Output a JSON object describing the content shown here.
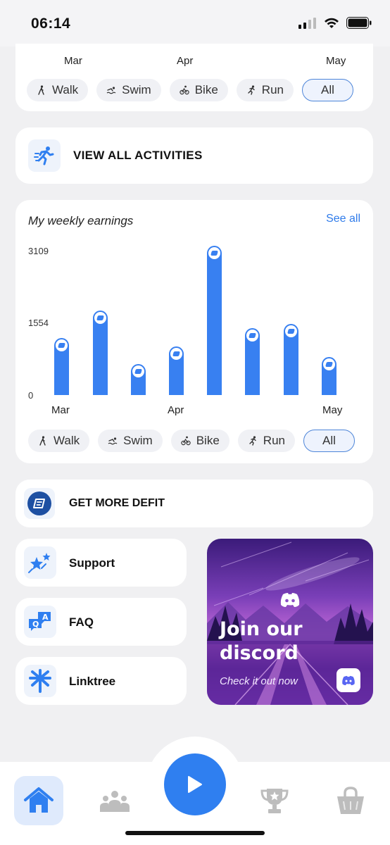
{
  "status_bar": {
    "time": "06:14"
  },
  "activity_chart": {
    "months": [
      "Mar",
      "Apr",
      "May"
    ]
  },
  "filters": [
    {
      "label": "Walk",
      "icon": "walk-icon"
    },
    {
      "label": "Swim",
      "icon": "swim-icon"
    },
    {
      "label": "Bike",
      "icon": "bike-icon"
    },
    {
      "label": "Run",
      "icon": "run-icon"
    },
    {
      "label": "All",
      "selected": true
    }
  ],
  "view_all": {
    "label": "VIEW ALL ACTIVITIES",
    "icon": "running-person-icon"
  },
  "earnings": {
    "title": "My weekly earnings",
    "see_all": "See all"
  },
  "chart_data": {
    "type": "bar",
    "y_ticks": [
      "3109",
      "1554",
      "0"
    ],
    "x_ticks": [
      "Mar",
      "Apr",
      "May"
    ],
    "ylim": [
      0,
      3109
    ],
    "values": [
      1240,
      1840,
      680,
      1050,
      3250,
      1450,
      1540,
      830
    ],
    "bar_color": "#3880f1",
    "grid": false,
    "legend": "none"
  },
  "get_defit": {
    "label": "GET MORE DEFIT",
    "icon": "defit-coin-icon"
  },
  "links": [
    {
      "label": "Support",
      "icon": "stars-icon"
    },
    {
      "label": "FAQ",
      "icon": "qa-bubbles-icon"
    },
    {
      "label": "Linktree",
      "icon": "linktree-icon"
    }
  ],
  "discord": {
    "title_line1": "Join our",
    "title_line2": "discord",
    "subtitle": "Check it out now",
    "icon": "discord-icon"
  },
  "tabbar": {
    "items": [
      "home-icon",
      "community-icon",
      "play-icon",
      "trophy-icon",
      "shop-bag-icon"
    ],
    "active": "home-icon"
  },
  "colors": {
    "accent": "#2f7ff0",
    "bar": "#3880f1",
    "page_bg": "#f0f0f2"
  }
}
